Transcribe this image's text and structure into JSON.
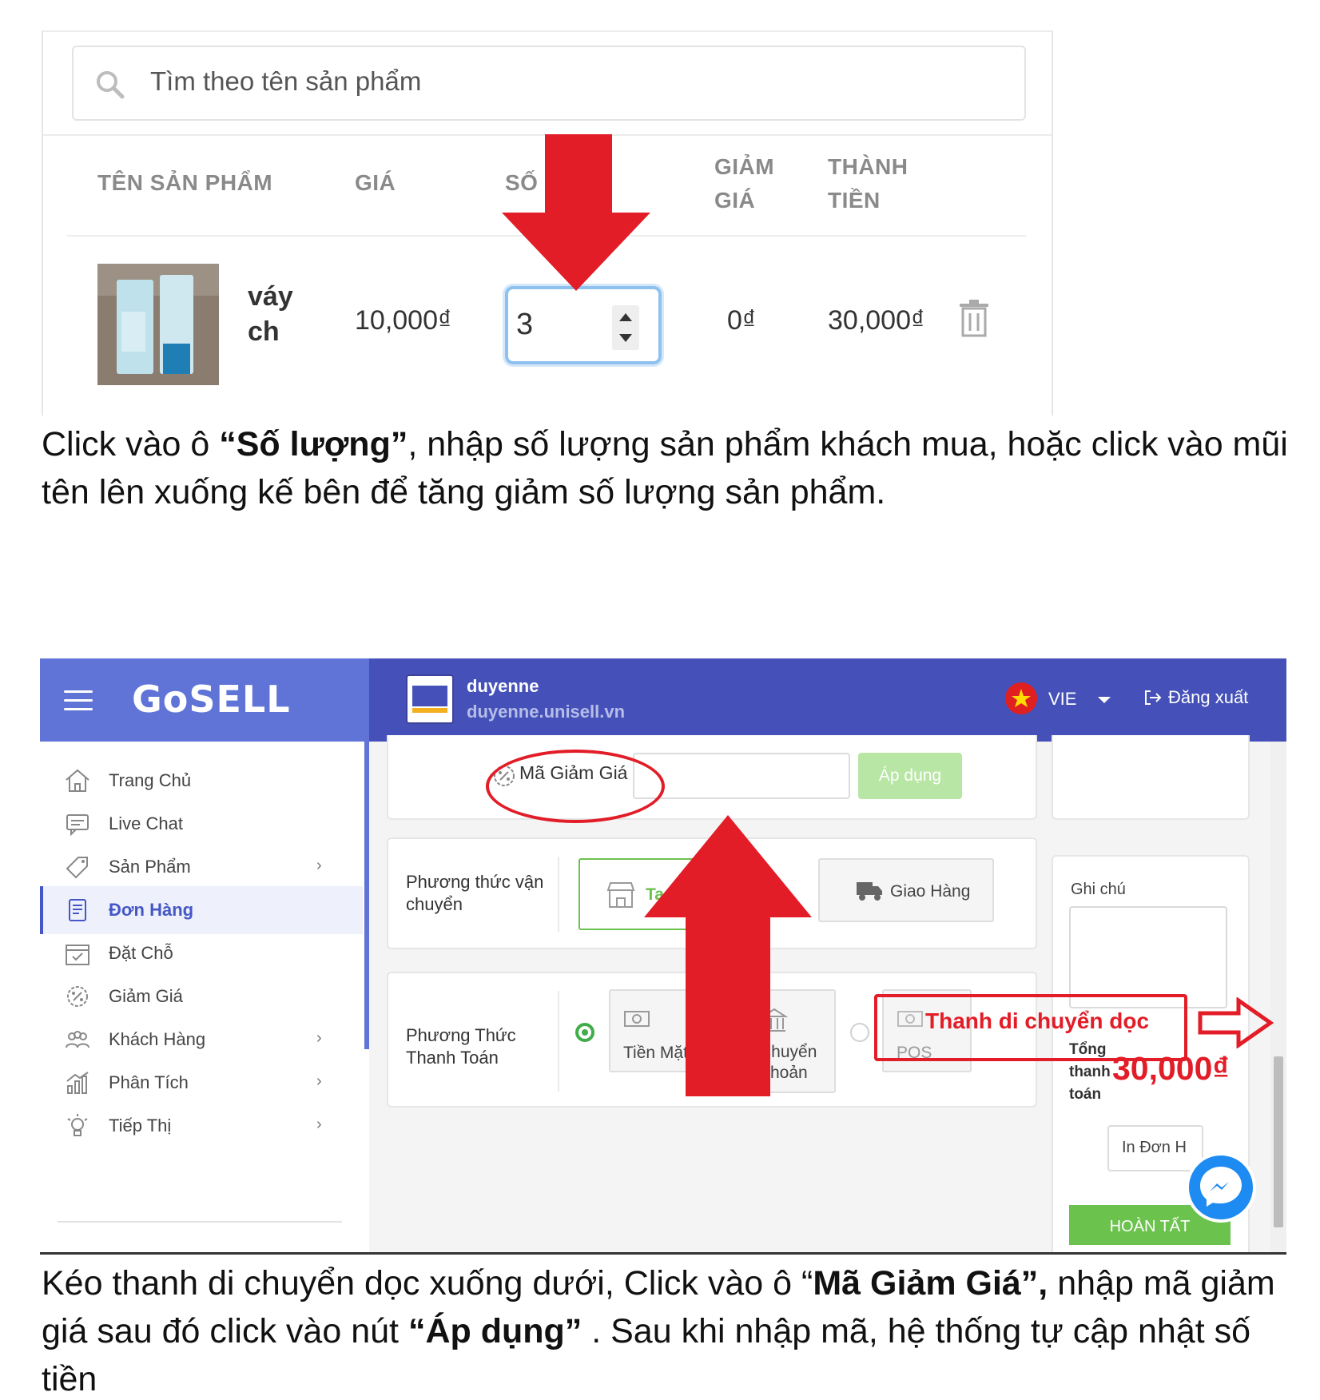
{
  "screen1": {
    "search_placeholder": "Tìm theo tên sản phẩm",
    "columns": [
      "TÊN SẢN PHẨM",
      "GIÁ",
      "SỐ",
      "GIẢM",
      "GIÁ",
      "THÀNH",
      "TIỀN"
    ],
    "row": {
      "name_line1": "váy",
      "name_line2": "ch",
      "price": "10,000₫",
      "quantity": "3",
      "discount": "0₫",
      "total": "30,000₫"
    }
  },
  "caption1": {
    "part1": "Click vào ô ",
    "bold1": "“Số lượng”",
    "part2": ", nhập số lượng sản phẩm khách mua, hoặc click vào mũi tên lên xuống kế bên để tăng giảm số lượng sản phẩm."
  },
  "screen2": {
    "brand": "GoSELL",
    "store_name": "duyenne",
    "store_url": "duyenne.unisell.vn",
    "language": "VIE",
    "logout": "Đăng xuất",
    "sidebar": [
      {
        "label": "Trang Chủ",
        "icon": "home-icon",
        "chevron": ""
      },
      {
        "label": "Live Chat",
        "icon": "chat-icon",
        "chevron": ""
      },
      {
        "label": "Sản Phẩm",
        "icon": "tag-icon",
        "chevron": "›"
      },
      {
        "label": "Đơn Hàng",
        "icon": "order-icon",
        "chevron": ""
      },
      {
        "label": "Đặt Chỗ",
        "icon": "calendar-icon",
        "chevron": ""
      },
      {
        "label": "Giảm Giá",
        "icon": "discount-icon",
        "chevron": ""
      },
      {
        "label": "Khách Hàng",
        "icon": "customers-icon",
        "chevron": "›"
      },
      {
        "label": "Phân Tích",
        "icon": "analytics-icon",
        "chevron": "›"
      },
      {
        "label": "Tiếp Thị",
        "icon": "marketing-icon",
        "chevron": "›"
      }
    ],
    "active_nav": "Đơn Hàng",
    "coupon_label": "Mã Giảm Giá",
    "coupon_value": "",
    "apply_button": "Áp dụng",
    "shipping_label": "Phương thức vận chuyển",
    "shipping_options": [
      "Ta",
      "Giao Hàng"
    ],
    "payment_label": "Phương Thức Thanh Toán",
    "payment_options": [
      "Tiền Mặt",
      "Chuyển Khoản",
      "POS"
    ],
    "note_label": "Ghi chú",
    "total_label": [
      "Tổng",
      "thanh",
      "toán"
    ],
    "total_value": "30,000₫",
    "print_button": "In Đơn H",
    "done_button": "HOÀN TẤT",
    "annotation": "Thanh di chuyển dọc"
  },
  "caption2": {
    "part1": "Kéo thanh di chuyển dọc xuống dưới, Click vào ô “",
    "bold1": "Mã Giảm Giá”,",
    "part2": " nhập mã giảm giá sau đó click vào nút ",
    "bold2": "“Áp dụng”",
    "part3": " . Sau khi nhập mã, hệ thống tự cập nhật số tiền"
  },
  "colors": {
    "accent_blue": "#5f74d6",
    "topbar_blue": "#4551b8",
    "annotation_red": "#e21d27",
    "success_green": "#6bc24d"
  }
}
